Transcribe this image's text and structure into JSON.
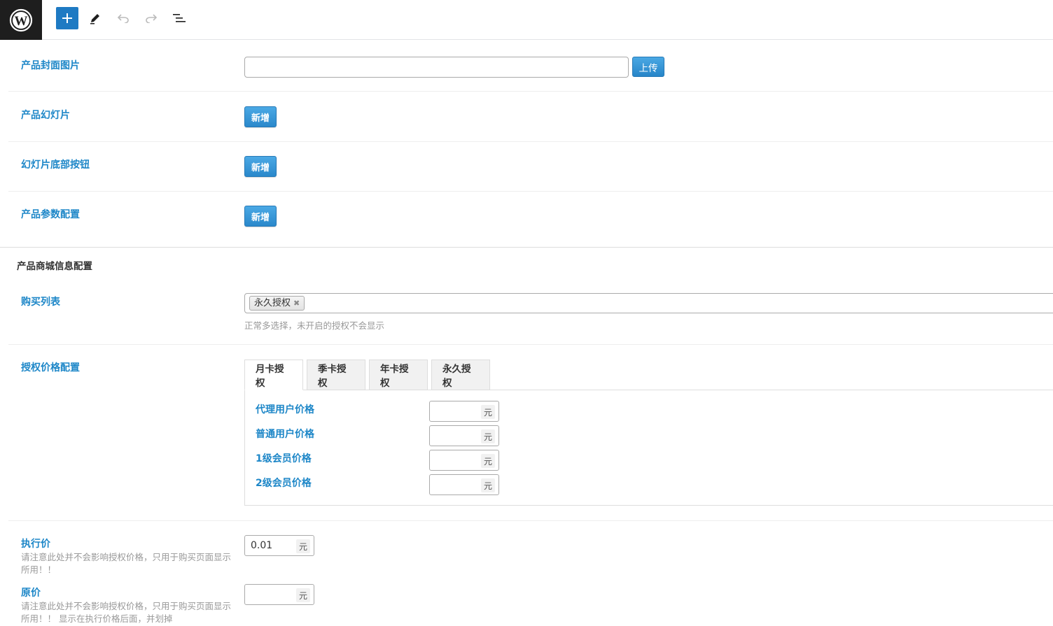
{
  "toolbar": {
    "logo": "wordpress-icon",
    "buttons": [
      "add-block",
      "edit-tool",
      "undo",
      "redo",
      "document-outline"
    ]
  },
  "fields": {
    "cover_image": {
      "label": "产品封面图片",
      "upload_label": "上传",
      "value": ""
    },
    "slideshow": {
      "label": "产品幻灯片",
      "add_label": "新增"
    },
    "slide_buttons": {
      "label": "幻灯片底部按钮",
      "add_label": "新增"
    },
    "params": {
      "label": "产品参数配置",
      "add_label": "新增"
    }
  },
  "shop_section": {
    "title": "产品商城信息配置",
    "purchase_list": {
      "label": "购买列表",
      "tags": [
        "永久授权"
      ],
      "hint": "正常多选择，未开启的授权不会显示"
    },
    "license_price": {
      "label": "授权价格配置",
      "tabs": [
        "月卡授权",
        "季卡授权",
        "年卡授权",
        "永久授权"
      ],
      "active_tab": "月卡授权",
      "rows": [
        {
          "label": "代理用户价格",
          "value": "",
          "unit": "元"
        },
        {
          "label": "普通用户价格",
          "value": "",
          "unit": "元"
        },
        {
          "label": "1级会员价格",
          "value": "",
          "unit": "元"
        },
        {
          "label": "2级会员价格",
          "value": "",
          "unit": "元"
        }
      ]
    },
    "exec_price": {
      "label": "执行价",
      "value": "0.01",
      "unit": "元",
      "desc": "请注意此处并不会影响授权价格，只用于购买页面显示所用！！"
    },
    "orig_price": {
      "label": "原价",
      "value": "",
      "unit": "元",
      "desc": "请注意此处并不会影响授权价格，只用于购买页面显示所用！！ 显示在执行价格后面，并划掉"
    }
  }
}
